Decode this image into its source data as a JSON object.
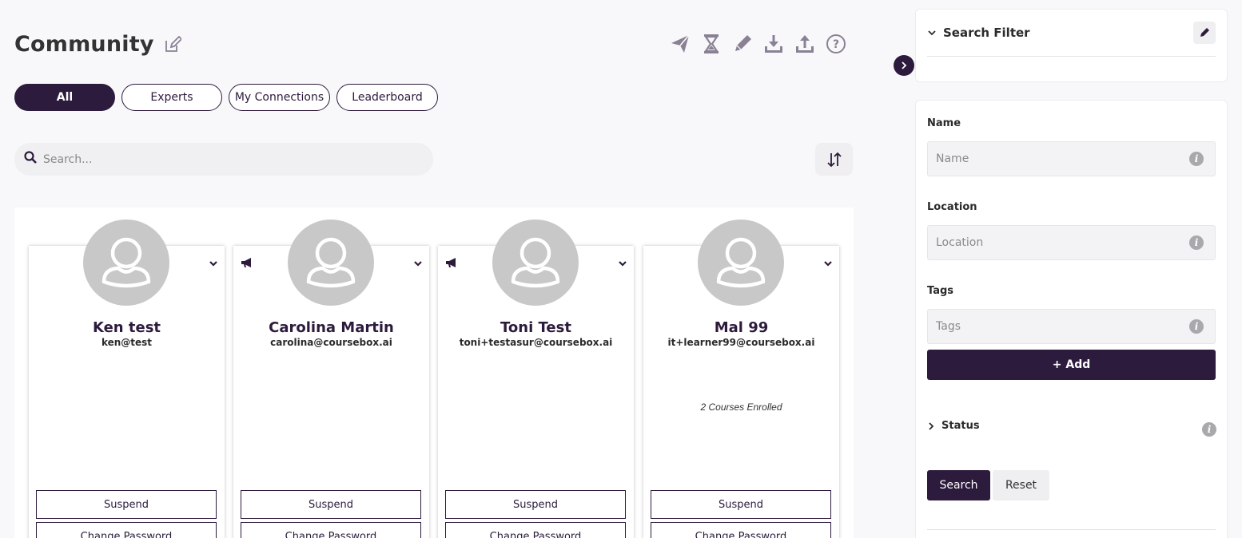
{
  "page": {
    "title": "Community"
  },
  "tabs": [
    {
      "label": "All",
      "active": true
    },
    {
      "label": "Experts",
      "active": false
    },
    {
      "label": "My Connections",
      "active": false
    },
    {
      "label": "Leaderboard",
      "active": false
    }
  ],
  "toolbar": {
    "icons": [
      "send-icon",
      "hourglass-icon",
      "pencil-icon",
      "download-icon",
      "upload-icon",
      "help-icon"
    ]
  },
  "search": {
    "placeholder": "Search..."
  },
  "members": [
    {
      "name": "Ken test",
      "email": "ken@test",
      "enrolled": "",
      "has_megaphone": false,
      "suspend_label": "Suspend",
      "change_password_label": "Change Password"
    },
    {
      "name": "Carolina Martin",
      "email": "carolina@coursebox.ai",
      "enrolled": "",
      "has_megaphone": true,
      "suspend_label": "Suspend",
      "change_password_label": "Change Password"
    },
    {
      "name": "Toni Test",
      "email": "toni+testasur@coursebox.ai",
      "enrolled": "",
      "has_megaphone": true,
      "suspend_label": "Suspend",
      "change_password_label": "Change Password"
    },
    {
      "name": "Mal 99",
      "email": "it+learner99@coursebox.ai",
      "enrolled": "2 Courses Enrolled",
      "has_megaphone": false,
      "suspend_label": "Suspend",
      "change_password_label": "Change Password"
    }
  ],
  "filter": {
    "title": "Search Filter",
    "name_label": "Name",
    "name_placeholder": "Name",
    "location_label": "Location",
    "location_placeholder": "Location",
    "tags_label": "Tags",
    "tags_placeholder": "Tags",
    "add_label": "+ Add",
    "status_label": "Status",
    "search_label": "Search",
    "reset_label": "Reset"
  },
  "colors": {
    "brand": "#2d1b3d",
    "icon_gray": "#8a8195",
    "avatar_gray": "#c8c8c8"
  }
}
